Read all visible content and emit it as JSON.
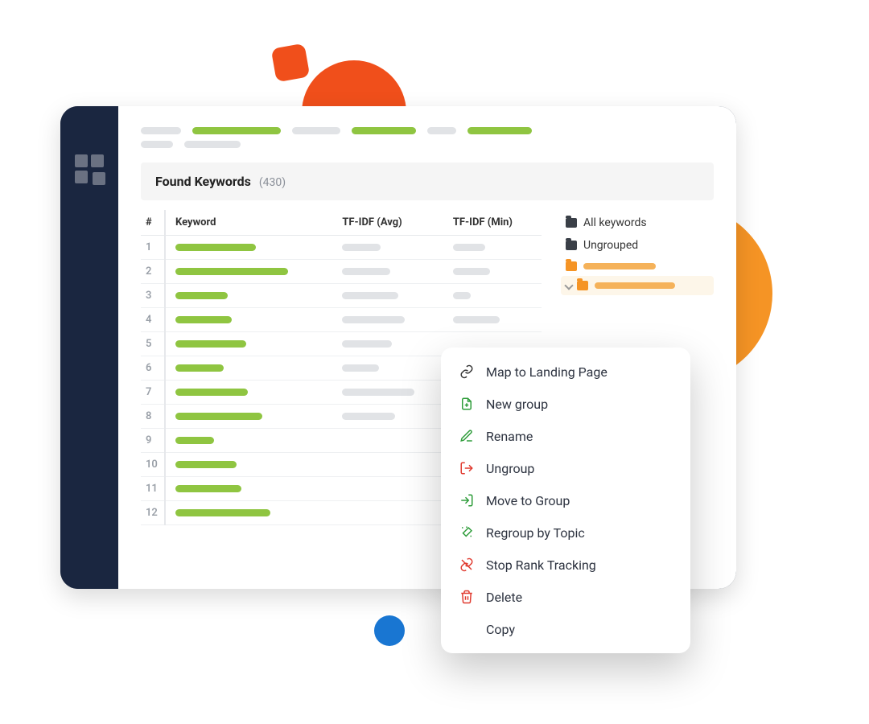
{
  "section": {
    "title": "Found Keywords",
    "count": "(430)"
  },
  "table": {
    "headers": {
      "num": "#",
      "keyword": "Keyword",
      "avg": "TF-IDF (Avg)",
      "min": "TF-IDF (Min)"
    },
    "rows": [
      {
        "n": "1",
        "kw": 100,
        "avg": 48,
        "min": 40
      },
      {
        "n": "2",
        "kw": 140,
        "avg": 60,
        "min": 46
      },
      {
        "n": "3",
        "kw": 65,
        "avg": 70,
        "min": 22
      },
      {
        "n": "4",
        "kw": 70,
        "avg": 78,
        "min": 58
      },
      {
        "n": "5",
        "kw": 88,
        "avg": 62,
        "min": 0
      },
      {
        "n": "6",
        "kw": 60,
        "avg": 46,
        "min": 0
      },
      {
        "n": "7",
        "kw": 90,
        "avg": 90,
        "min": 0
      },
      {
        "n": "8",
        "kw": 108,
        "avg": 66,
        "min": 0
      },
      {
        "n": "9",
        "kw": 48,
        "avg": 0,
        "min": 0
      },
      {
        "n": "10",
        "kw": 76,
        "avg": 0,
        "min": 0
      },
      {
        "n": "11",
        "kw": 82,
        "avg": 0,
        "min": 0
      },
      {
        "n": "12",
        "kw": 118,
        "avg": 0,
        "min": 0
      }
    ]
  },
  "groups": {
    "all": "All keywords",
    "ungrouped": "Ungrouped"
  },
  "menu": {
    "map": "Map to Landing Page",
    "new": "New group",
    "rename": "Rename",
    "ungroup": "Ungroup",
    "move": "Move to Group",
    "regroup": "Regroup by Topic",
    "stop": "Stop Rank Tracking",
    "delete": "Delete",
    "copy": "Copy"
  }
}
